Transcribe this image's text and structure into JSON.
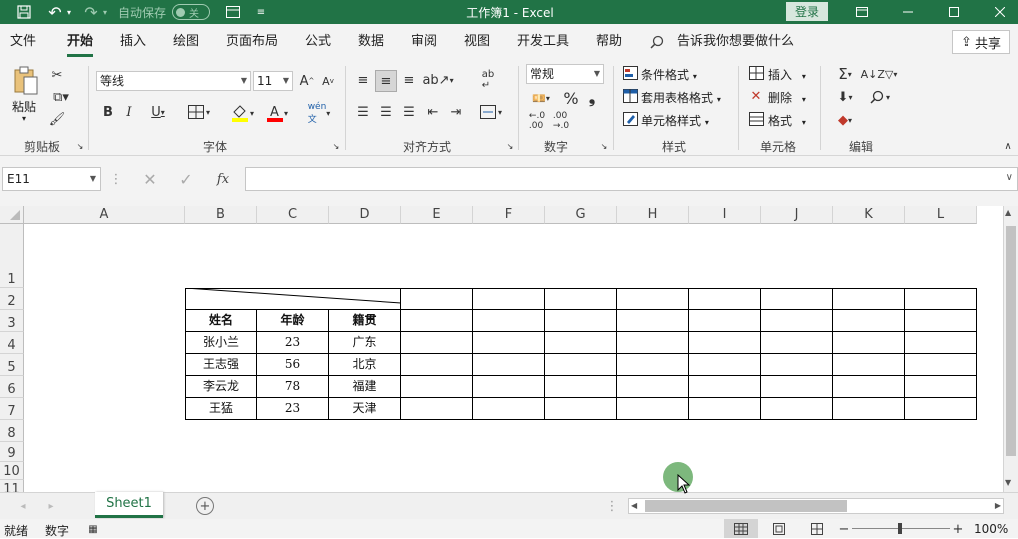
{
  "titlebar": {
    "autosave": "自动保存",
    "toggle": "关",
    "title": "工作簿1  -  Excel",
    "login": "登录"
  },
  "menu": {
    "items": [
      "文件",
      "开始",
      "插入",
      "绘图",
      "页面布局",
      "公式",
      "数据",
      "审阅",
      "视图",
      "开发工具",
      "帮助"
    ],
    "tell": "告诉我你想要做什么",
    "share": "共享"
  },
  "ribbon": {
    "paste": "粘贴",
    "font_name": "等线",
    "font_size": "11",
    "number_format": "常规",
    "conditional": "条件格式",
    "table_format": "套用表格格式",
    "cell_style": "单元格样式",
    "insert": "插入",
    "delete": "删除",
    "format": "格式",
    "groups": {
      "clipboard": "剪贴板",
      "font": "字体",
      "align": "对齐方式",
      "number": "数字",
      "styles": "样式",
      "cells": "单元格",
      "edit": "编辑"
    }
  },
  "formula": {
    "namebox": "E11",
    "fx": "fx"
  },
  "columns": [
    "A",
    "B",
    "C",
    "D",
    "E",
    "F",
    "G",
    "H",
    "I",
    "J",
    "K",
    "L"
  ],
  "rows": [
    "1",
    "2",
    "3",
    "4",
    "5",
    "6",
    "7",
    "8",
    "9",
    "10",
    "11"
  ],
  "table": {
    "headers": [
      "姓名",
      "年龄",
      "籍贯"
    ],
    "rows": [
      [
        "张小兰",
        "23",
        "广东"
      ],
      [
        "王志强",
        "56",
        "北京"
      ],
      [
        "李云龙",
        "78",
        "福建"
      ],
      [
        "王猛",
        "23",
        "天津"
      ]
    ]
  },
  "sheet": {
    "tab": "Sheet1"
  },
  "status": {
    "ready": "就绪",
    "mode": "数字",
    "zoom": "100%"
  },
  "colors": {
    "accent": "#217346"
  }
}
